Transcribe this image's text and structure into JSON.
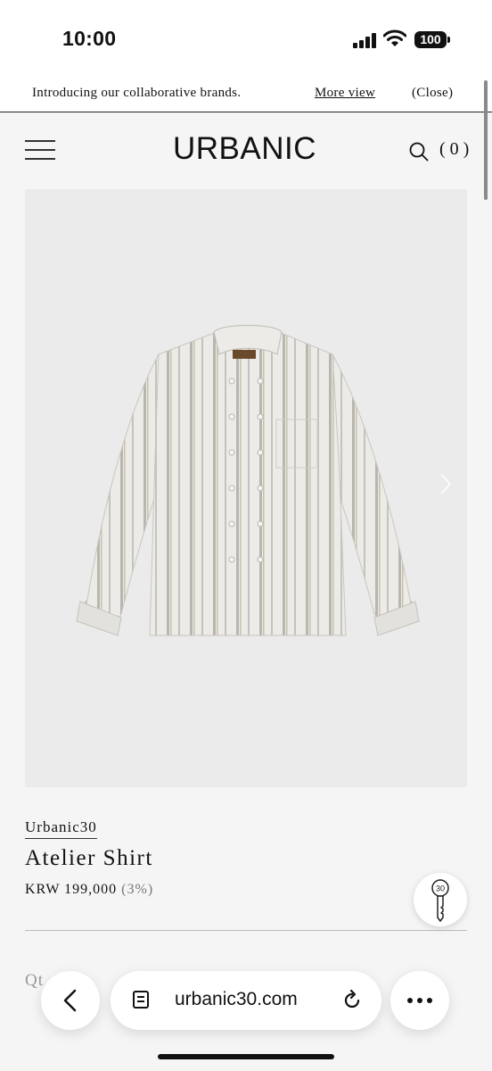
{
  "status": {
    "time": "10:00",
    "battery": "100"
  },
  "announcement": {
    "text": "Introducing our collaborative brands.",
    "more_label": "More view",
    "close_label": "(Close)"
  },
  "header": {
    "logo": "URBANIC",
    "cart_count": "(0)"
  },
  "product": {
    "brand": "Urbanic30",
    "name": "Atelier Shirt",
    "price": "KRW 199,000",
    "discount": "(3%)",
    "qty_label": "Qt"
  },
  "key_badge": "30",
  "browser": {
    "url": "urbanic30.com"
  },
  "icons": {
    "menu": "hamburger-icon",
    "search": "search-icon",
    "next": "chevron-right-icon",
    "key": "key-icon",
    "back": "chevron-left-icon",
    "tabs": "tabs-icon",
    "reload": "reload-icon",
    "more": "ellipsis-icon"
  }
}
